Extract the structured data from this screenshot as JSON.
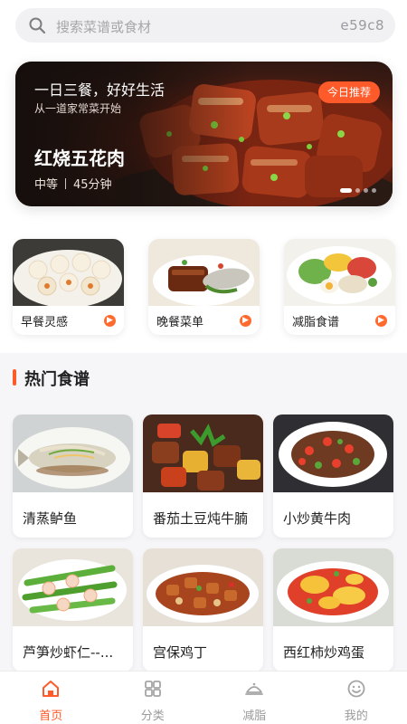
{
  "search": {
    "placeholder": "搜索菜谱或食材",
    "code": "e59c8"
  },
  "banner": {
    "slogan": "一日三餐，好好生活",
    "subtitle": "从一道家常菜开始",
    "dish": "红烧五花肉",
    "difficulty": "中等",
    "duration": "45分钟",
    "tag": "今日推荐",
    "slides": 4,
    "active_slide": 1
  },
  "categories": [
    {
      "label": "早餐灵感",
      "icon": "arrow-right-icon"
    },
    {
      "label": "晚餐菜单",
      "icon": "arrow-right-icon"
    },
    {
      "label": "减脂食谱",
      "icon": "arrow-right-icon"
    }
  ],
  "section": {
    "title": "热门食谱"
  },
  "recipes": [
    {
      "name": "清蒸鲈鱼"
    },
    {
      "name": "番茄土豆炖牛腩"
    },
    {
      "name": "小炒黄牛肉"
    },
    {
      "name": "芦笋炒虾仁--..."
    },
    {
      "name": "宫保鸡丁"
    },
    {
      "name": "西红柿炒鸡蛋"
    }
  ],
  "nav": {
    "items": [
      {
        "label": "首页",
        "icon": "home-icon",
        "active": true
      },
      {
        "label": "分类",
        "icon": "category-grid-icon",
        "active": false
      },
      {
        "label": "减脂",
        "icon": "dish-cover-icon",
        "active": false
      },
      {
        "label": "我的",
        "icon": "smile-face-icon",
        "active": false
      }
    ]
  },
  "colors": {
    "accent": "#ff5a2a",
    "background": "#f6f6f8"
  }
}
